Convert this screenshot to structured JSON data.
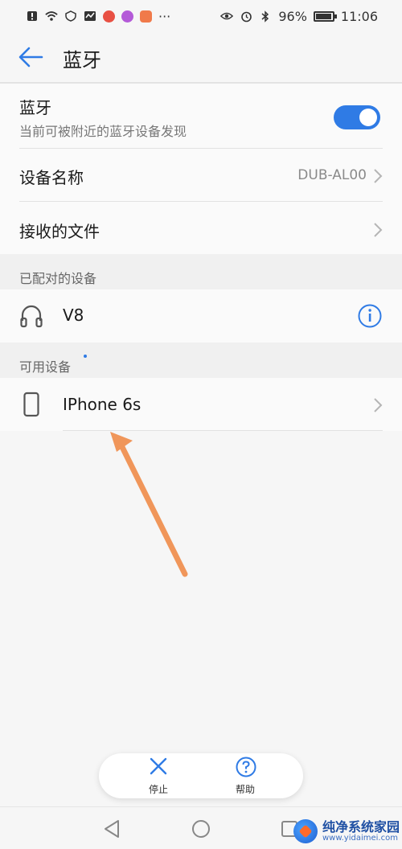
{
  "status_bar": {
    "battery_text": "96%",
    "battery_level": 0.96,
    "time": "11:06",
    "more_dots": "···"
  },
  "header": {
    "title": "蓝牙"
  },
  "bluetooth_row": {
    "label": "蓝牙",
    "description": "当前可被附近的蓝牙设备发现",
    "enabled": true,
    "accent_color": "#2f7be5"
  },
  "device_name_row": {
    "label": "设备名称",
    "value": "DUB-AL00"
  },
  "received_files_row": {
    "label": "接收的文件"
  },
  "paired_section": {
    "header": "已配对的设备",
    "devices": [
      {
        "name": "V8",
        "icon": "headphones-icon"
      }
    ]
  },
  "available_section": {
    "header": "可用设备",
    "devices": [
      {
        "name": "IPhone 6s",
        "icon": "phone-icon"
      }
    ]
  },
  "annotation": {
    "arrow_color": "#f0965a"
  },
  "bottom_actions": {
    "stop_label": "停止",
    "help_label": "帮助"
  },
  "watermark": {
    "name": "纯净系统家园",
    "url": "www.yidaimei.com"
  }
}
